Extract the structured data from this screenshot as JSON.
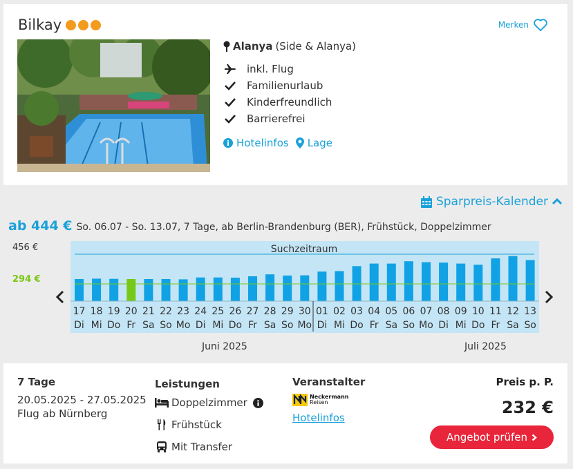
{
  "hotel": {
    "name": "Bilkay",
    "stars": 3,
    "merken_label": "Merken",
    "location_city": "Alanya",
    "location_region": "(Side & Alanya)",
    "features": [
      "inkl. Flug",
      "Familienurlaub",
      "Kinderfreundlich",
      "Barrierefrei"
    ],
    "links": {
      "hotelinfos": "Hotelinfos",
      "lage": "Lage"
    }
  },
  "calendar": {
    "toggle_label": "Sparpreis-Kalender",
    "price_from": "ab 444 €",
    "summary": "So. 06.07 - So. 13.07, 7 Tage, ab Berlin-Brandenburg (BER), Frühstück, Doppelzimmer",
    "y_max_label": "456 €",
    "y_min_label": "294 €",
    "search_range_label": "Suchzeitraum",
    "months": {
      "june": "Juni 2025",
      "july": "Juli 2025"
    },
    "colors": {
      "bar": "#10a2e4",
      "selected": "#77c919",
      "band": "#c4e5f5",
      "min_line": "#7bc817"
    }
  },
  "chart_data": {
    "type": "bar",
    "categories": [
      "17",
      "18",
      "19",
      "20",
      "21",
      "22",
      "23",
      "24",
      "25",
      "26",
      "27",
      "28",
      "29",
      "30",
      "01",
      "02",
      "03",
      "04",
      "05",
      "06",
      "07",
      "08",
      "09",
      "10",
      "11",
      "12",
      "13"
    ],
    "weekdays": [
      "Di",
      "Mi",
      "Do",
      "Fr",
      "Sa",
      "So",
      "Mo",
      "Di",
      "Mi",
      "Do",
      "Fr",
      "Sa",
      "So",
      "Mo",
      "Di",
      "Mi",
      "Do",
      "Fr",
      "Sa",
      "So",
      "Mo",
      "Di",
      "Mi",
      "Do",
      "Fr",
      "Sa",
      "So"
    ],
    "values": [
      294,
      296,
      295,
      294,
      294,
      294,
      293,
      301,
      301,
      300,
      306,
      314,
      309,
      310,
      326,
      328,
      349,
      360,
      360,
      370,
      366,
      364,
      360,
      355,
      382,
      392,
      375
    ],
    "selected_index": 3,
    "ylim": [
      200,
      400
    ]
  },
  "offer": {
    "duration": "7 Tage",
    "dates": "20.05.2025 - 27.05.2025",
    "flight": "Flug ab Nürnberg",
    "services_title": "Leistungen",
    "services": [
      "Doppelzimmer",
      "Frühstück",
      "Mit Transfer"
    ],
    "operator_title": "Veranstalter",
    "operator_logo_text": [
      "Neckermann",
      "Reisen"
    ],
    "hotelinfos": "Hotelinfos",
    "price_title": "Preis p. P.",
    "price": "232 €",
    "cta": "Angebot prüfen"
  }
}
